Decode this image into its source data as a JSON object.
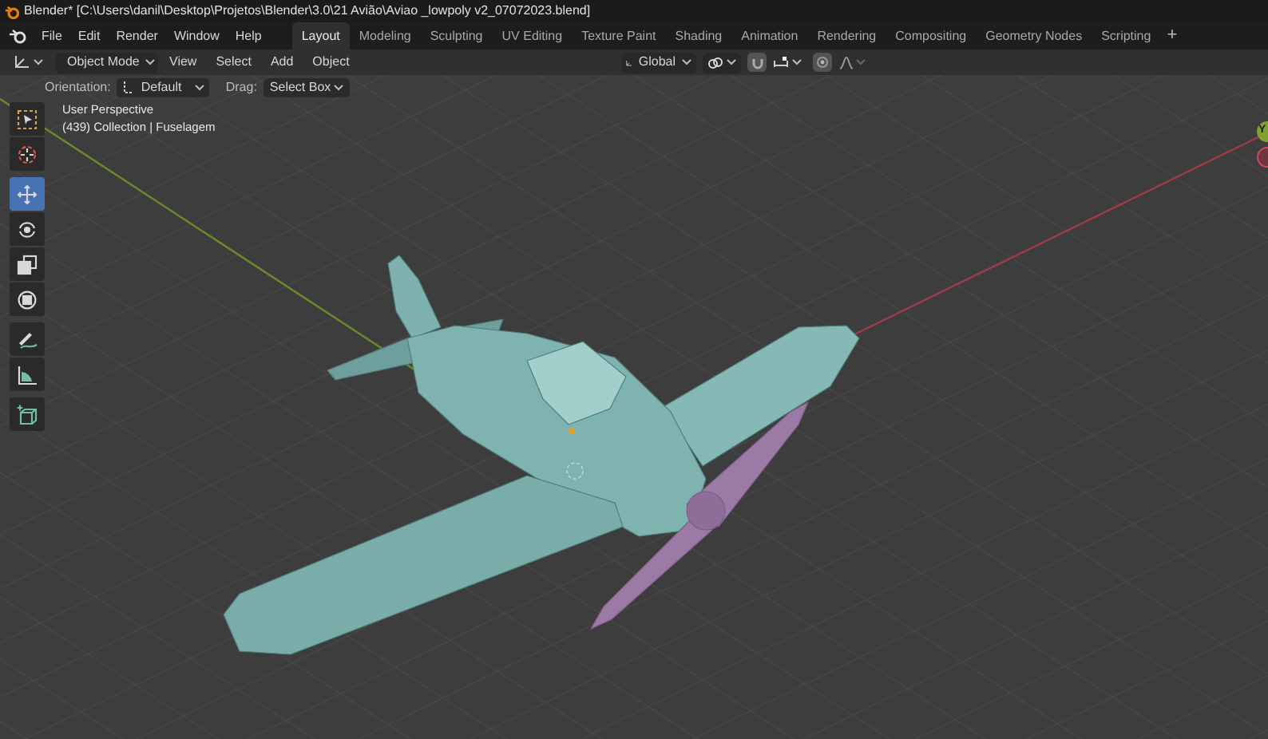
{
  "window": {
    "title": "Blender* [C:\\Users\\danil\\Desktop\\Projetos\\Blender\\3.0\\21 Avião\\Aviao _lowpoly v2_07072023.blend]"
  },
  "menus": [
    "File",
    "Edit",
    "Render",
    "Window",
    "Help"
  ],
  "workspace_tabs": [
    {
      "label": "Layout",
      "selected": true
    },
    {
      "label": "Modeling",
      "selected": false
    },
    {
      "label": "Sculpting",
      "selected": false
    },
    {
      "label": "UV Editing",
      "selected": false
    },
    {
      "label": "Texture Paint",
      "selected": false
    },
    {
      "label": "Shading",
      "selected": false
    },
    {
      "label": "Animation",
      "selected": false
    },
    {
      "label": "Rendering",
      "selected": false
    },
    {
      "label": "Compositing",
      "selected": false
    },
    {
      "label": "Geometry Nodes",
      "selected": false
    },
    {
      "label": "Scripting",
      "selected": false
    }
  ],
  "add_tab": "+",
  "header": {
    "mode": "Object Mode",
    "menus": [
      "View",
      "Select",
      "Add",
      "Object"
    ],
    "orientation": "Global",
    "snap_on": false,
    "proportional_on": false
  },
  "tool_settings": {
    "orientation_label": "Orientation:",
    "orientation": "Default",
    "drag_label": "Drag:",
    "drag": "Select Box"
  },
  "viewport": {
    "view_name": "User Perspective",
    "object_info": "(439) Collection | Fuselagem",
    "gizmo_y": "Y"
  },
  "tool_groups": [
    {
      "tools": [
        {
          "kind": "select",
          "selected": false
        },
        {
          "kind": "cursor",
          "selected": false
        }
      ]
    },
    {
      "tools": [
        {
          "kind": "move",
          "selected": true
        },
        {
          "kind": "rotate",
          "selected": false
        },
        {
          "kind": "scale",
          "selected": false
        },
        {
          "kind": "transform",
          "selected": false
        }
      ]
    },
    {
      "tools": [
        {
          "kind": "annotate",
          "selected": false
        },
        {
          "kind": "measure",
          "selected": false
        }
      ]
    },
    {
      "tools": [
        {
          "kind": "add",
          "selected": false
        }
      ]
    }
  ]
}
